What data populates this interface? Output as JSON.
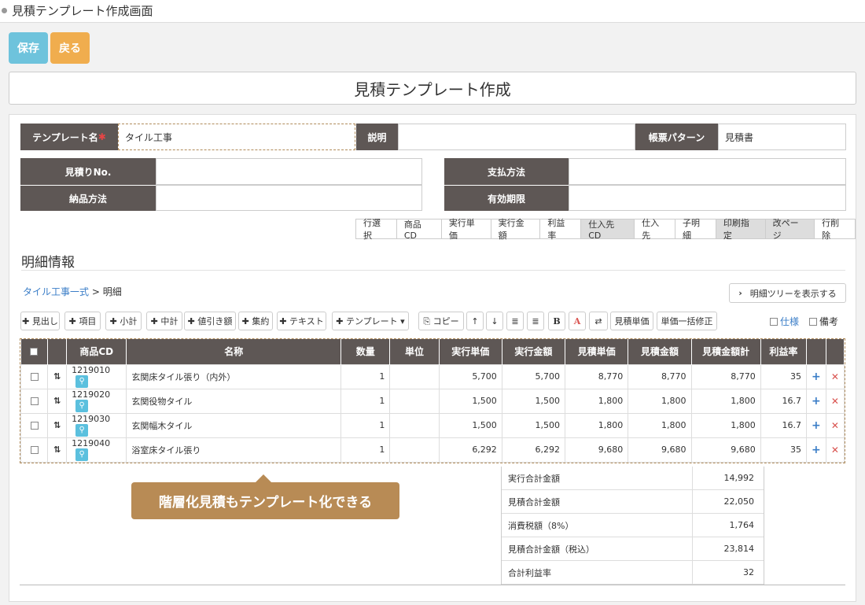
{
  "caption": "見積テンプレート作成画面",
  "buttons": {
    "save": "保存",
    "back": "戻る"
  },
  "page_title": "見積テンプレート作成",
  "fields": {
    "template_name_label": "テンプレート名",
    "required_mark": "✱",
    "template_name_value": "タイル工事",
    "description_label": "説明",
    "description_value": "",
    "form_pattern_label": "帳票パターン",
    "form_pattern_value": "見積書",
    "quote_no_label": "見積りNo.",
    "payment_label": "支払方法",
    "delivery_label": "納品方法",
    "expiry_label": "有効期限"
  },
  "column_tabs": [
    {
      "label": "行選択",
      "on": false
    },
    {
      "label": "商品CD",
      "on": false
    },
    {
      "label": "実行単価",
      "on": false
    },
    {
      "label": "実行金額",
      "on": false
    },
    {
      "label": "利益率",
      "on": false
    },
    {
      "label": "仕入先CD",
      "on": true
    },
    {
      "label": "仕入先",
      "on": false
    },
    {
      "label": "子明細",
      "on": false
    },
    {
      "label": "印刷指定",
      "on": true
    },
    {
      "label": "改ページ",
      "on": true
    },
    {
      "label": "行削除",
      "on": false
    }
  ],
  "section_title": "明細情報",
  "breadcrumb": {
    "link": "タイル工事一式",
    "sep": ">",
    "current": "明細"
  },
  "tree_button": "明細ツリーを表示する",
  "toolbar": [
    "✚ 見出し",
    "✚ 項目",
    "✚ 小計",
    "✚ 中計",
    "✚ 値引き額",
    "✚ 集約",
    "✚ テキスト",
    "✚ テンプレート ▾",
    "⎘ コピー",
    "↑",
    "↓",
    "≣",
    "≣",
    "B",
    "A",
    "⇄",
    "見積単価",
    "単価一括修正"
  ],
  "checks": {
    "spec": "仕様",
    "note": "備考"
  },
  "table": {
    "headers": [
      "",
      "",
      "商品CD",
      "名称",
      "数量",
      "単位",
      "実行単価",
      "実行金額",
      "見積単価",
      "見積金額",
      "見積金額計",
      "利益率",
      "",
      ""
    ],
    "rows": [
      {
        "code": "1219010",
        "name": "玄関床タイル張り（内外）",
        "qty": "1",
        "unit": "",
        "exec_price": "5,700",
        "exec_amount": "5,700",
        "quote_price": "8,770",
        "quote_amount": "8,770",
        "quote_total": "8,770",
        "margin": "35"
      },
      {
        "code": "1219020",
        "name": "玄関役物タイル",
        "qty": "1",
        "unit": "",
        "exec_price": "1,500",
        "exec_amount": "1,500",
        "quote_price": "1,800",
        "quote_amount": "1,800",
        "quote_total": "1,800",
        "margin": "16.7"
      },
      {
        "code": "1219030",
        "name": "玄関幅木タイル",
        "qty": "1",
        "unit": "",
        "exec_price": "1,500",
        "exec_amount": "1,500",
        "quote_price": "1,800",
        "quote_amount": "1,800",
        "quote_total": "1,800",
        "margin": "16.7"
      },
      {
        "code": "1219040",
        "name": "浴室床タイル張り",
        "qty": "1",
        "unit": "",
        "exec_price": "6,292",
        "exec_amount": "6,292",
        "quote_price": "9,680",
        "quote_amount": "9,680",
        "quote_total": "9,680",
        "margin": "35"
      }
    ]
  },
  "summary": [
    {
      "label": "実行合計金額",
      "value": "14,992"
    },
    {
      "label": "見積合計金額",
      "value": "22,050"
    },
    {
      "label": "消費税額（8%）",
      "value": "1,764"
    },
    {
      "label": "見積合計金額（税込）",
      "value": "23,814"
    },
    {
      "label": "合計利益率",
      "value": "32"
    }
  ],
  "callout": "階層化見積もテンプレート化できる",
  "colors": {
    "label_bg": "#5e5755",
    "save": "#6ec3dc",
    "back": "#f0ad4e",
    "callout": "#b88b55",
    "link": "#3a7dc7"
  }
}
